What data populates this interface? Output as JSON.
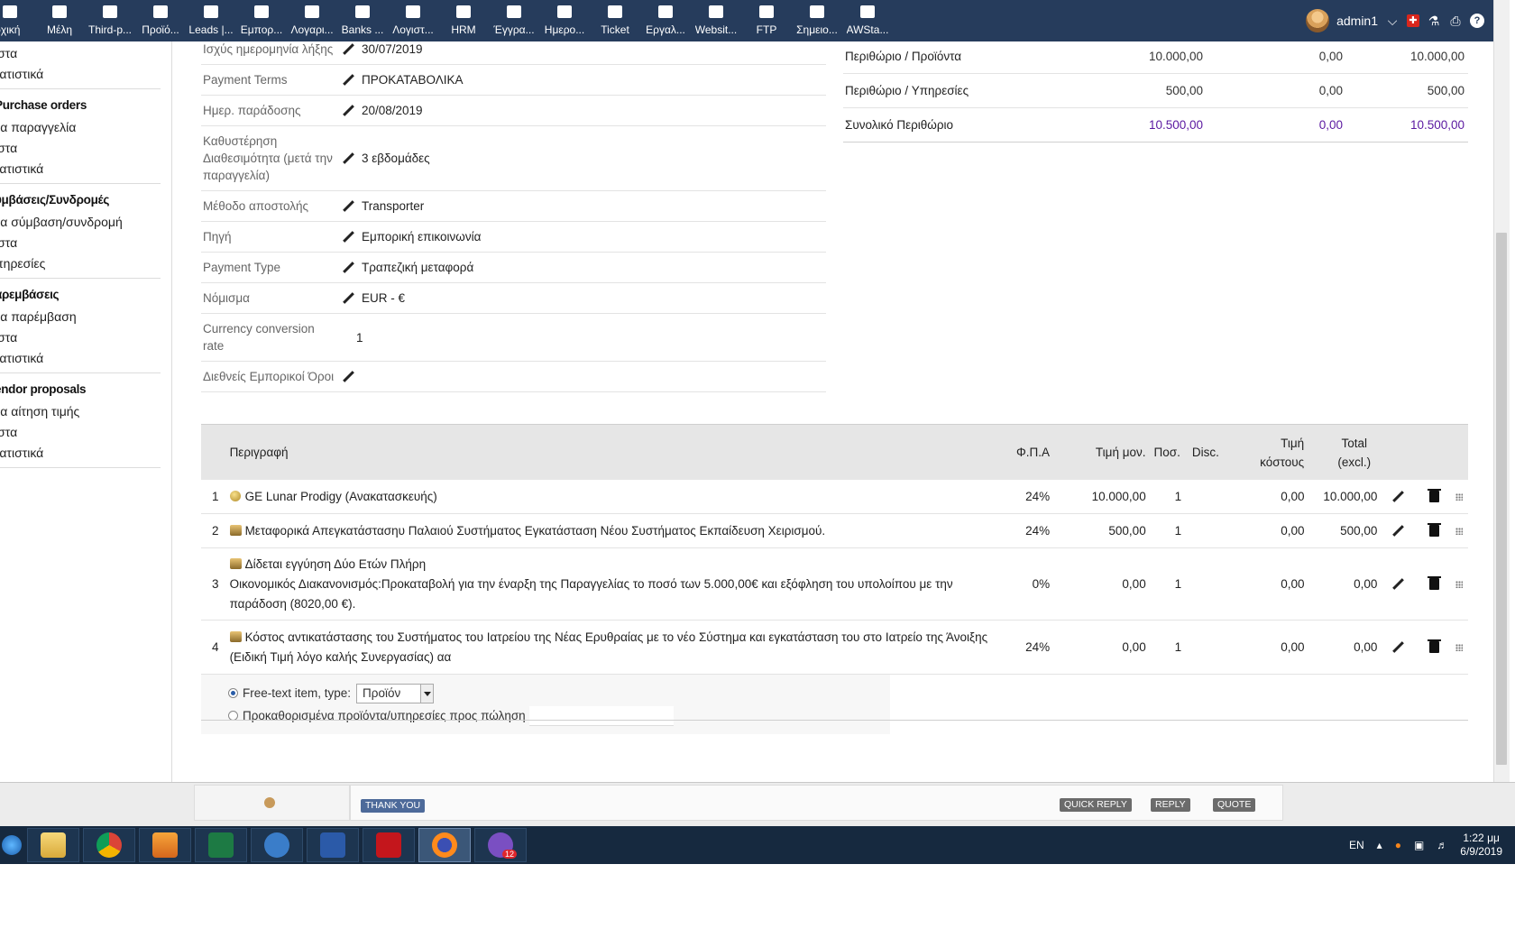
{
  "nav": {
    "items": [
      {
        "label": "ρχική",
        "icon": "home-icon"
      },
      {
        "label": "Μέλη",
        "icon": "users-icon"
      },
      {
        "label": "Third-p...",
        "icon": "building-icon"
      },
      {
        "label": "Προϊό...",
        "icon": "cube-icon"
      },
      {
        "label": "Leads |...",
        "icon": "sitemap-icon"
      },
      {
        "label": "Εμπορ...",
        "icon": "briefcase-icon"
      },
      {
        "label": "Λογαρι...",
        "icon": "invoice-icon"
      },
      {
        "label": "Banks ...",
        "icon": "bank-icon"
      },
      {
        "label": "Λογιστ...",
        "icon": "money-icon"
      },
      {
        "label": "HRM",
        "icon": "person-icon"
      },
      {
        "label": "Έγγρα...",
        "icon": "folder-icon"
      },
      {
        "label": "Ημερο...",
        "icon": "calendar-icon"
      },
      {
        "label": "Ticket",
        "icon": "ticket-icon"
      },
      {
        "label": "Εργαλ...",
        "icon": "wrench-icon"
      },
      {
        "label": "Websit...",
        "icon": "network-icon"
      },
      {
        "label": "FTP",
        "icon": "exchange-icon"
      },
      {
        "label": "Σημειο...",
        "icon": "cash-register-icon"
      },
      {
        "label": "AWSta...",
        "icon": "stats-icon"
      }
    ],
    "user": "admin1"
  },
  "sidebar": {
    "top_links": [
      "ίστα",
      "τατιστικά"
    ],
    "groups": [
      {
        "title": "Purchase orders",
        "links": [
          "έα παραγγελία",
          "ίστα",
          "τατιστικά"
        ]
      },
      {
        "title": "υμβάσεις/Συνδρομές",
        "links": [
          "έα σύμβαση/συνδρομή",
          "ίστα",
          "πηρεσίες"
        ]
      },
      {
        "title": "αρεμβάσεις",
        "links": [
          "έα παρέμβαση",
          "ίστα",
          "τατιστικά"
        ]
      },
      {
        "title": "endor proposals",
        "links": [
          "έα αίτηση τιμής",
          "ίστα",
          "τατιστικά"
        ]
      }
    ]
  },
  "fields": [
    {
      "label": "Ισχύς ημερομηνία λήξης",
      "value": "30/07/2019",
      "edit": true
    },
    {
      "label": "Payment Terms",
      "value": "ΠΡΟΚΑΤΑΒΟΛΙΚΑ",
      "edit": true
    },
    {
      "label": "Ημερ. παράδοσης",
      "value": "20/08/2019",
      "edit": true
    },
    {
      "label": "Καθυστέρηση Διαθεσιμότητα (μετά την παραγγελία)",
      "value": "3 εβδομάδες",
      "edit": true
    },
    {
      "label": "Μέθοδο αποστολής",
      "value": "Transporter",
      "edit": true
    },
    {
      "label": "Πηγή",
      "value": "Εμπορική επικοινωνία",
      "edit": true
    },
    {
      "label": "Payment Type",
      "value": "Τραπεζική μεταφορά",
      "edit": true
    },
    {
      "label": "Νόμισμα",
      "value": "EUR - €",
      "edit": true
    },
    {
      "label": "Currency conversion rate",
      "value": "1",
      "edit": false
    },
    {
      "label": "Διεθνείς Εμπορικοί Όροι",
      "value": "",
      "edit": true
    }
  ],
  "margins": [
    {
      "label": "Περιθώριο / Προϊόντα",
      "a": "10.000,00",
      "b": "0,00",
      "c": "10.000,00"
    },
    {
      "label": "Περιθώριο / Υπηρεσίες",
      "a": "500,00",
      "b": "0,00",
      "c": "500,00"
    },
    {
      "label": "Συνολικό Περιθώριο",
      "a": "10.500,00",
      "b": "0,00",
      "c": "10.500,00"
    }
  ],
  "lines": {
    "headers": {
      "desc": "Περιγραφή",
      "vat": "Φ.Π.Α",
      "price": "Τιμή μον.",
      "qty": "Ποσ.",
      "disc": "Disc.",
      "cost_1": "Τιμή",
      "cost_2": "κόστους",
      "total_1": "Total",
      "total_2": "(excl.)"
    },
    "rows": [
      {
        "num": "1",
        "type": "product",
        "desc": "GE Lunar Prodigy (Ανακατασκευής)",
        "desc2": "",
        "vat": "24%",
        "price": "10.000,00",
        "qty": "1",
        "disc": "",
        "cost": "0,00",
        "total": "10.000,00"
      },
      {
        "num": "2",
        "type": "service",
        "desc": "Μεταφορικά Απεγκατάστασηυ Παλαιού Συστήματος Εγκατάσταση  Νέου Συστήματος Εκπαίδευση Χειρισμού.",
        "desc2": "",
        "vat": "24%",
        "price": "500,00",
        "qty": "1",
        "disc": "",
        "cost": "0,00",
        "total": "500,00"
      },
      {
        "num": "3",
        "type": "service",
        "desc": "Δίδεται εγγύηση Δύο Ετών Πλήρη",
        "desc2": "Οικονομικός Διακανονισμός:Προκαταβολή για την έναρξη της Παραγγελίας το ποσό των 5.000,00€ και εξόφληση του υπολοίπου με την παράδοση (8020,00 €).",
        "vat": "0%",
        "price": "0,00",
        "qty": "1",
        "disc": "",
        "cost": "0,00",
        "total": "0,00"
      },
      {
        "num": "4",
        "type": "service",
        "desc": "Κόστος αντικατάστασης  του Συστήματος του Ιατρείου της  Νέας Ερυθραίας με το νέο Σύστημα και εγκατάσταση του στο Ιατρείο της Άνοιξης (Ειδική Τιμή λόγο καλής Συνεργασίας)  αα",
        "desc2": "",
        "vat": "24%",
        "price": "0,00",
        "qty": "1",
        "disc": "",
        "cost": "0,00",
        "total": "0,00"
      }
    ],
    "add": {
      "free_text_label": "Free-text item, type:",
      "free_text_type": "Προϊόν",
      "predefined_label": "Προκαθορισμένα προϊόντα/υπηρεσίες προς πώληση"
    }
  },
  "backwindow": {
    "thank_you": "THANK YOU",
    "quick_reply": "QUICK REPLY",
    "reply": "REPLY",
    "quote": "QUOTE"
  },
  "taskbar": {
    "apps": [
      "windows-start-icon",
      "file-explorer-icon",
      "chrome-icon",
      "media-player-icon",
      "excel-icon",
      "outlook-icon",
      "word-icon",
      "acrobat-icon",
      "firefox-icon",
      "viber-icon"
    ],
    "viber_badge": "12",
    "lang": "EN",
    "time": "1:22 μμ",
    "date": "6/9/2019"
  }
}
